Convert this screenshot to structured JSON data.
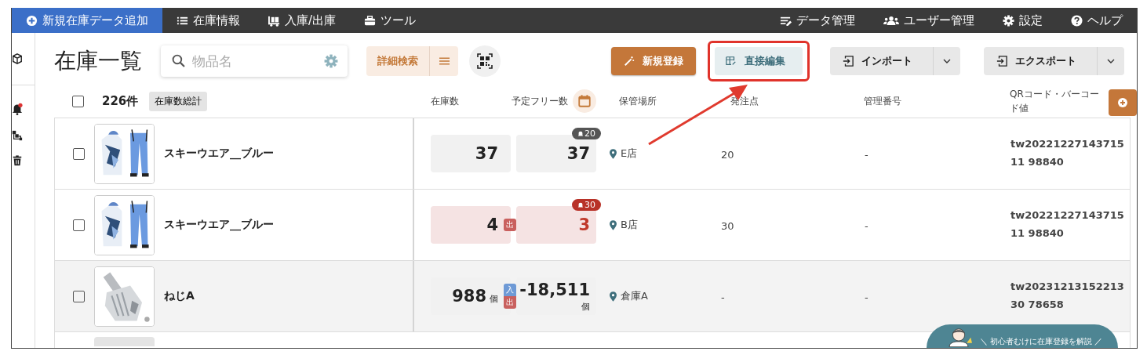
{
  "nav": {
    "left": [
      {
        "label": "新規在庫データ追加",
        "selected": true
      },
      {
        "label": "在庫情報",
        "selected": false
      },
      {
        "label": "入庫/出庫",
        "selected": false
      },
      {
        "label": "ツール",
        "selected": false
      }
    ],
    "right": [
      {
        "label": "データ管理"
      },
      {
        "label": "ユーザー管理"
      },
      {
        "label": "設定"
      },
      {
        "label": "ヘルプ"
      }
    ]
  },
  "sidebar": {
    "unread": true
  },
  "toolbar": {
    "title": "在庫一覧",
    "search": {
      "placeholder": "物品名"
    },
    "detail_search": "詳細検索",
    "buttons": [
      {
        "label": "新規登録",
        "kind": "primary",
        "highlighted": false
      },
      {
        "label": "直接編集",
        "kind": "soft",
        "highlighted": true
      },
      {
        "label": "インポート",
        "kind": "split",
        "highlighted": false
      },
      {
        "label": "エクスポート",
        "kind": "split",
        "highlighted": false
      }
    ]
  },
  "list": {
    "select_all": false,
    "count": "226件",
    "total_button": "在庫数総計",
    "columns": [
      "在庫数",
      "予定フリー数",
      "保管場所",
      "発注点",
      "管理番号",
      "QRコード・バーコード値"
    ]
  },
  "rows": [
    {
      "checked": false,
      "image": {
        "kind": "picture"
      },
      "name": "スキーウエア__ブルー",
      "stock": "37",
      "free": "37",
      "alert": {
        "label": "20",
        "low": false
      },
      "tags": [],
      "location": "E店",
      "reorder_point": "20",
      "management_no": "-",
      "code": "tw2022122714371511 98840",
      "shaded": false
    },
    {
      "checked": false,
      "image": {
        "kind": "picture"
      },
      "name": "スキーウエア__ブルー",
      "stock": "4",
      "free": "3",
      "alert": {
        "label": "30",
        "low": true
      },
      "tags": [
        {
          "label": "出",
          "kind": "out"
        }
      ],
      "location": "B店",
      "reorder_point": "30",
      "management_no": "-",
      "code": "tw2022122714371511 98840",
      "shaded": false
    },
    {
      "checked": false,
      "image": {
        "kind": "picture"
      },
      "name": "ねじA",
      "stock": "988",
      "stock_unit": "個",
      "free": "-18,511",
      "free_unit": "個",
      "tags": [
        {
          "label": "入",
          "kind": "in"
        },
        {
          "label": "出",
          "kind": "out"
        }
      ],
      "location": "倉庫A",
      "reorder_point": "-",
      "management_no": "-",
      "code": "tw2023121315221330 78658",
      "shaded": true
    }
  ],
  "help_banner": {
    "text": "＼ 初心者むけに在庫登録を解説 ／"
  }
}
